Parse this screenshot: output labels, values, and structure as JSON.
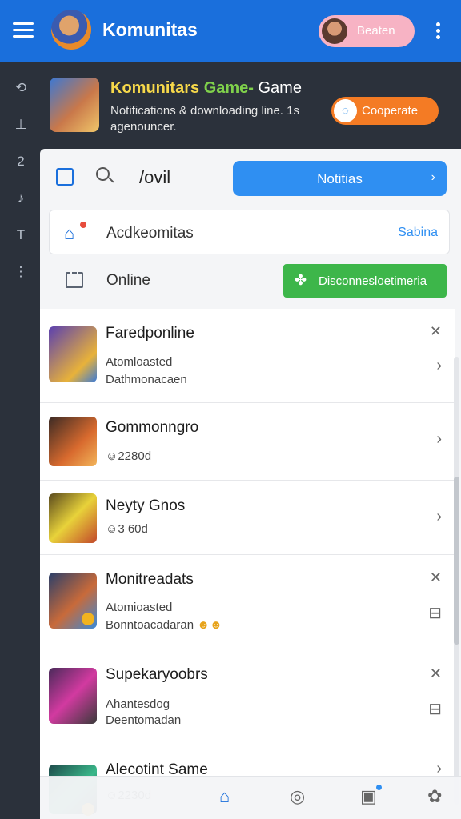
{
  "topbar": {
    "title": "Komunitas",
    "pill_label": "Beaten",
    "colors": {
      "bar": "#1a6fdc",
      "pill": "#f7b3c4"
    }
  },
  "rail": {
    "icons": [
      "refresh-icon",
      "up-arrow-icon",
      "number-icon",
      "music-note-icon",
      "text-tool-icon",
      "more-vertical-icon"
    ]
  },
  "hero": {
    "title_part1": "Komunitars ",
    "title_part2": "Game-",
    "title_part3": " Game",
    "subtitle": "Notifications & downloading line. 1s agenouncer.",
    "button_label": "Cooperate",
    "button_icon": "chat-icon"
  },
  "panel": {
    "head_label": "/ovil",
    "primary_button": "Notitias",
    "row_a": {
      "label": "Acdkeomitas",
      "link": "Sabina"
    },
    "row_b": {
      "label": "Online",
      "button": "Disconnesloetimeria"
    }
  },
  "list": {
    "items": [
      {
        "name": "Faredponline",
        "line1": "Atomloasted",
        "line2": "Dathmonacaen",
        "meta": ""
      },
      {
        "name": "Gommonngro",
        "line1": "",
        "line2": "",
        "meta": "2280d"
      },
      {
        "name": "Neyty Gnos",
        "line1": "",
        "line2": "",
        "meta": "3 60d"
      },
      {
        "name": "Monitreadats",
        "line1": "Atomioasted",
        "line2": "Bonntoacadaran",
        "meta": ""
      },
      {
        "name": "Supekaryoobrs",
        "line1": "Ahantesdog",
        "line2": "Deentomadan",
        "meta": ""
      },
      {
        "name": "Alecotint Same",
        "line1": "",
        "line2": "",
        "meta": "2230d"
      }
    ]
  },
  "bottomnav": {
    "icons": [
      "home-icon",
      "location-icon",
      "inbox-icon",
      "settings-icon"
    ]
  }
}
